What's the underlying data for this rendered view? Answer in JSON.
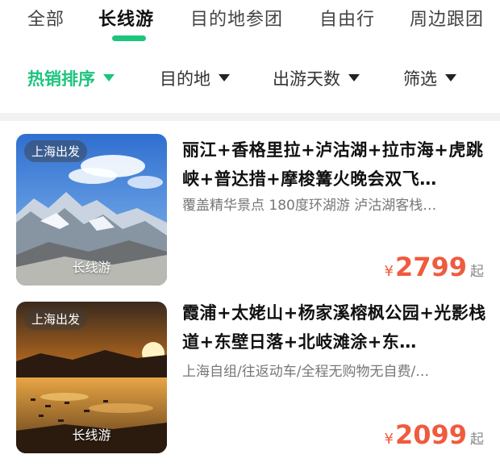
{
  "tabs": [
    {
      "label": "全部"
    },
    {
      "label": "长线游",
      "active": true
    },
    {
      "label": "目的地参团"
    },
    {
      "label": "自由行"
    },
    {
      "label": "周边跟团"
    }
  ],
  "filters": [
    {
      "label": "热销排序",
      "active": true
    },
    {
      "label": "目的地"
    },
    {
      "label": "出游天数"
    },
    {
      "label": "筛选"
    }
  ],
  "products": [
    {
      "tag": "上海出发",
      "caption": "长线游",
      "title": "丽江+香格里拉+泸沽湖+拉市海+虎跳峡+普达措+摩梭篝火晚会双飞…",
      "subtitle": "覆盖精华景点 180度环湖游 泸沽湖客栈…",
      "currency": "¥",
      "price": "2799",
      "unit": "起",
      "image": "snow-mountain"
    },
    {
      "tag": "上海出发",
      "caption": "长线游",
      "title": "霞浦+太姥山+杨家溪榕枫公园+光影栈道+东壁日落+北岐滩涂+东…",
      "subtitle": "上海自组/往返动车/全程无购物无自费/…",
      "currency": "¥",
      "price": "2099",
      "unit": "起",
      "image": "sunset-coast"
    }
  ],
  "colors": {
    "accent": "#1cc47d",
    "price": "#f05a3e"
  }
}
